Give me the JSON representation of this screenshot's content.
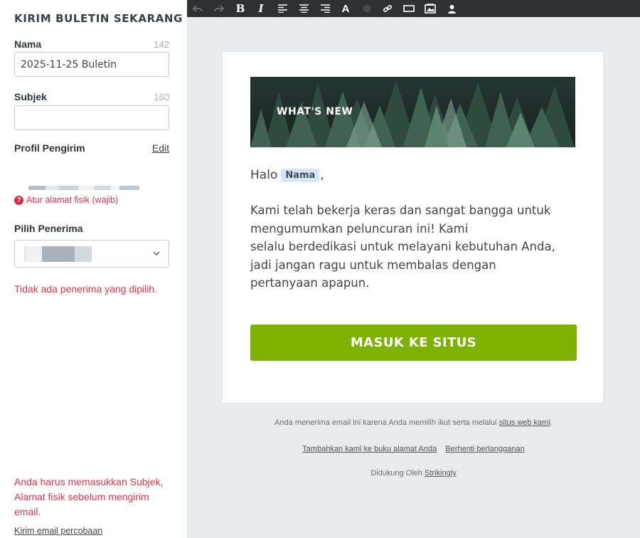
{
  "left_panel": {
    "title": "KIRIM BULETIN SEKARANG",
    "name_field": {
      "label": "Nama",
      "counter": "142",
      "value": "2025-11-25 Buletin"
    },
    "subject_field": {
      "label": "Subjek",
      "counter": "160",
      "value": "",
      "placeholder": ""
    },
    "sender_profile": {
      "label": "Profil Pengirim",
      "edit_label": "Edit"
    },
    "physical_address_warning": "Atur alamat fisik (wajib)",
    "recipients": {
      "label": "Pilih Penerima",
      "no_recipient_error": "Tidak ada penerima yang dipilih."
    },
    "send_error": "Anda harus memasukkan Subjek, Alamat fisik sebelum mengirim email.",
    "test_email_link": "Kirim email percobaan"
  },
  "toolbar": {
    "icons": [
      "undo-icon",
      "redo-icon",
      "bold-icon",
      "italic-icon",
      "align-left-icon",
      "align-center-icon",
      "align-right-icon",
      "font-color-icon",
      "color-dot-icon",
      "link-icon",
      "button-icon",
      "image-icon",
      "person-icon"
    ]
  },
  "email": {
    "hero_text": "WHAT'S NEW",
    "greeting_prefix": "Halo",
    "merge_tag": "Nama",
    "greeting_suffix": ",",
    "body_lines": [
      "Kami telah bekerja keras dan sangat bangga untuk",
      "mengumumkan peluncuran ini! Kami",
      "selalu berdedikasi untuk melayani kebutuhan Anda,",
      "jadi jangan ragu untuk membalas dengan",
      "pertanyaan apapun."
    ],
    "cta_label": "MASUK KE SITUS"
  },
  "footer": {
    "reason_text": "Anda menerima email ini karena Anda memilih ikut serta melalui",
    "reason_link": "situs web kami",
    "reason_suffix": ".",
    "address_book_link": "Tambahkan kami ke buku alamat Anda",
    "unsubscribe_link": "Berhenti berlangganan",
    "powered_prefix": "Didukung Oleh",
    "powered_link": "Strikingly"
  },
  "colors": {
    "accent_green": "#7eb200",
    "error_red": "#e0334b",
    "toolbar_bg": "#2f3033",
    "canvas_bg": "#e8eaed"
  }
}
